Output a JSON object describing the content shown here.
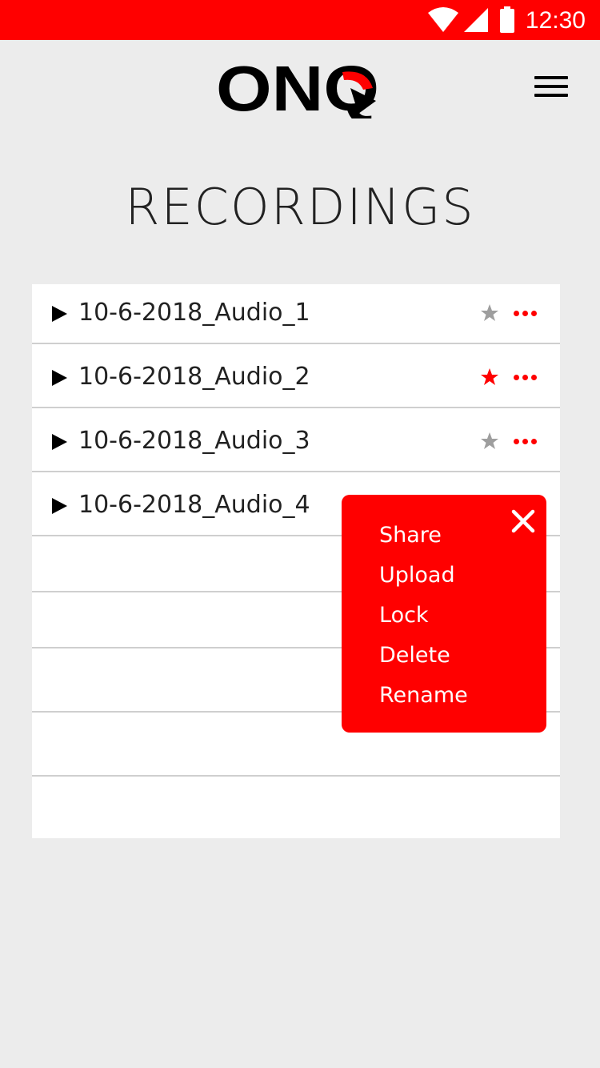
{
  "status_bar": {
    "time": "12:30",
    "background": "#ff0000"
  },
  "header": {
    "logo_text": "ONQ",
    "menu_icon": "hamburger-icon"
  },
  "page": {
    "title": "RECORDINGS"
  },
  "recordings": [
    {
      "name": "10-6-2018_Audio_1",
      "starred": false
    },
    {
      "name": "10-6-2018_Audio_2",
      "starred": true
    },
    {
      "name": "10-6-2018_Audio_3",
      "starred": false
    },
    {
      "name": "10-6-2018_Audio_4",
      "starred": false
    }
  ],
  "context_menu": {
    "items": [
      "Share",
      "Upload",
      "Lock",
      "Delete",
      "Rename"
    ],
    "close_icon": "close-icon"
  },
  "colors": {
    "accent": "#ff0000",
    "star_inactive": "#9e9e9e",
    "background": "#ececec"
  }
}
